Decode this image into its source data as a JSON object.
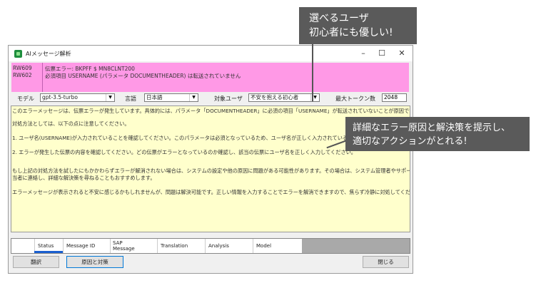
{
  "window": {
    "title": "AIメッセージ解析",
    "controls": {
      "minimize": "–",
      "maximize": "☐",
      "close": "✕"
    }
  },
  "messages": [
    {
      "code": "RW609",
      "text": "伝票エラー: BKPFF $ MN8CLNT200"
    },
    {
      "code": "RW602",
      "text": "必須項目 USERNAME (パラメータ DOCUMENTHEADER) は転送されていません"
    }
  ],
  "options": {
    "model_label": "モデル",
    "model_value": "gpt-3.5-turbo",
    "language_label": "言語",
    "language_value": "日本語",
    "user_label": "対象ユーザ",
    "user_value": "不安を抱える初心者",
    "max_tokens_label": "最大トークン数",
    "max_tokens_value": "2048"
  },
  "content": {
    "lines": [
      "このエラーメッセージは、伝票エラーが発生しています。具体的には、パラメータ「DOCUMENTHEADER」に必須の項目「USERNAME」が転送されていないことが原因です。",
      "対処方法としては、以下の点に注意してください。",
      "1. ユーザ名(USERNAME)が入力されていることを確認してください。このパラメータは必須となっているため、ユーザ名が正しく入力されているか確",
      "2. エラーが発生した伝票の内容を確認してください。どの伝票がエラーとなっているのか確認し、該当の伝票にユーザ名を正しく入力してください。",
      "もし上記の対処方法を試したにもかかわらずエラーが解消されない場合は、システムの設定や他の原因に問題がある可能性があります。その場合は、システム管理者やサポート担",
      "当者に連絡し、詳細な解決策を尋ねることもおすすめします。",
      "エラーメッセージが表示されると不安に感じるかもしれませんが、問題は解決可能です。正しい情報を入力することでエラーを解消できますので、焦らず冷静に対処してください。"
    ]
  },
  "grid": {
    "columns": [
      "Status",
      "Message ID",
      "SAP\nMessage",
      "Translation",
      "Analysis",
      "Model"
    ]
  },
  "buttons": {
    "translate": "翻訳",
    "cause": "原因と対策",
    "close": "閉じる"
  },
  "callouts": {
    "top": [
      "選べるユーザ",
      "初心者にも優しい!"
    ],
    "right": [
      "詳細なエラー原因と解決策を提示し、",
      "適切なアクションがとれる!"
    ]
  }
}
